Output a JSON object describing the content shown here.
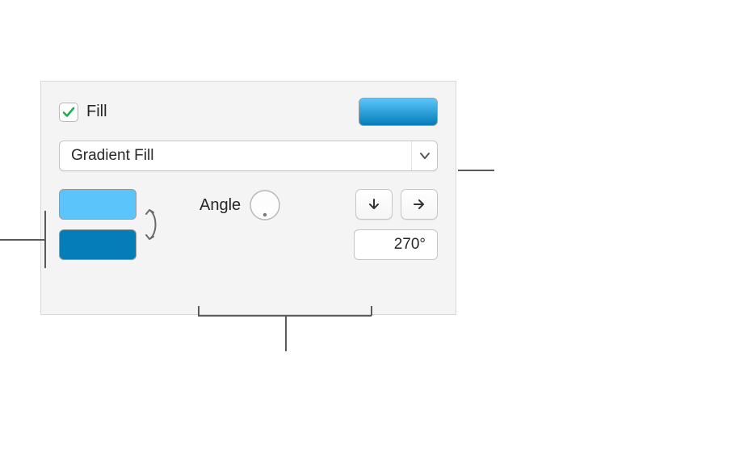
{
  "header": {
    "checkbox_checked": true,
    "fill_label": "Fill"
  },
  "dropdown": {
    "selected": "Gradient Fill"
  },
  "gradient": {
    "color1": "#5bc5fb",
    "color2": "#047db8"
  },
  "angle": {
    "label": "Angle",
    "value": "270°"
  }
}
